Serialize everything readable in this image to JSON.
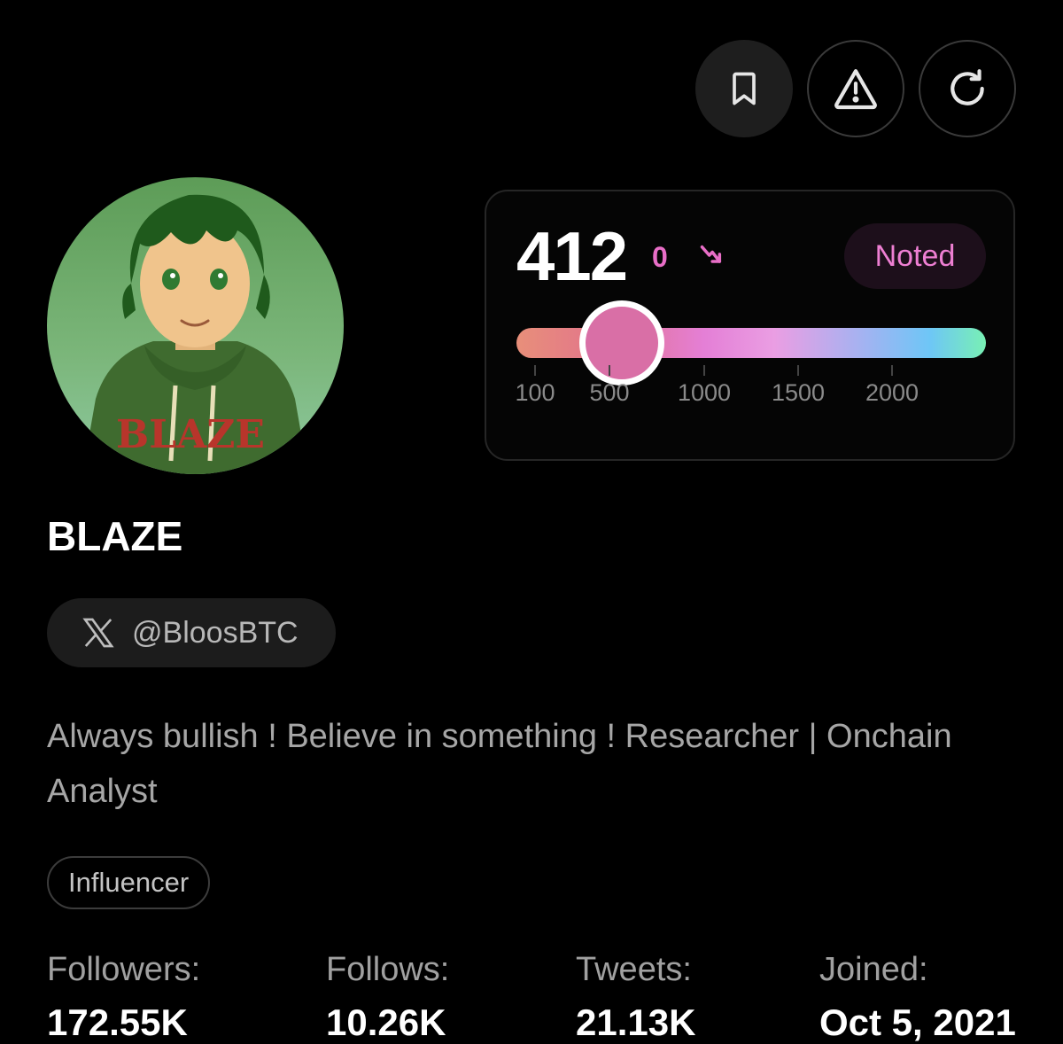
{
  "actions": {
    "bookmark_icon": "bookmark-icon",
    "report_icon": "warning-triangle-icon",
    "refresh_icon": "refresh-icon"
  },
  "profile": {
    "name": "BLAZE",
    "handle": "@BloosBTC",
    "handle_icon": "x-logo-icon",
    "bio": "Always bullish ! Believe in something ! Researcher | Onchain Analyst",
    "tag": "Influencer",
    "avatar_text": "BLAZE"
  },
  "score": {
    "value": "412",
    "delta": "0",
    "status": "Noted",
    "scale_labels": [
      "100",
      "500",
      "1000",
      "1500",
      "2000"
    ],
    "scale_values": [
      100,
      500,
      1000,
      1500,
      2000
    ],
    "current": 412
  },
  "stats": [
    {
      "label": "Followers:",
      "value": "172.55K"
    },
    {
      "label": "Follows:",
      "value": "10.26K"
    },
    {
      "label": "Tweets:",
      "value": "21.13K"
    },
    {
      "label": "Joined:",
      "value": "Oct 5, 2021"
    }
  ],
  "colors": {
    "background": "#000000",
    "accent_pink": "#e86ec7",
    "badge_text": "#ee7fd3",
    "thumb": "#d96fa6"
  }
}
